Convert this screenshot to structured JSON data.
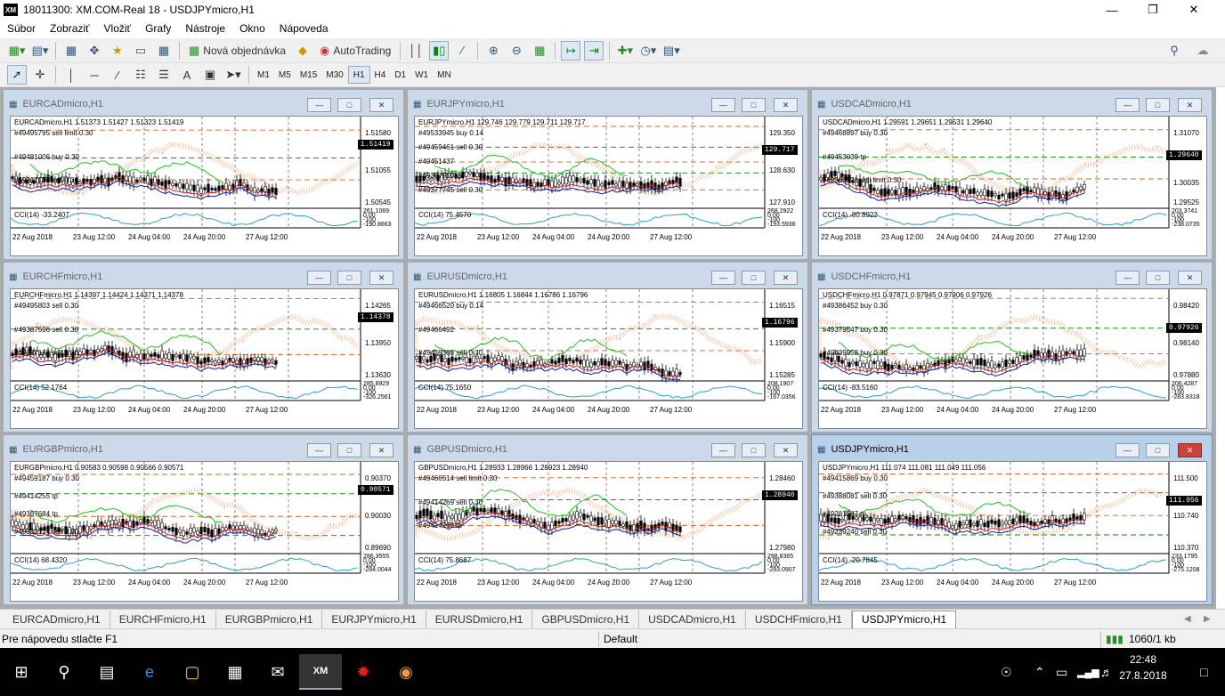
{
  "window": {
    "title": "18011300: XM.COM-Real 18 - USDJPYmicro,H1",
    "app_icon": "XM"
  },
  "menu": [
    "Súbor",
    "Zobraziť",
    "Vložiť",
    "Grafy",
    "Nástroje",
    "Okno",
    "Nápoveda"
  ],
  "toolbar": {
    "new_order": "Nová objednávka",
    "autotrading": "AutoTrading"
  },
  "timeframes": [
    "M1",
    "M5",
    "M15",
    "M30",
    "H1",
    "H4",
    "D1",
    "W1",
    "MN"
  ],
  "active_timeframe": "H1",
  "x_axis_labels": [
    "22 Aug 2018",
    "23 Aug 12:00",
    "24 Aug 04:00",
    "24 Aug 20:00",
    "27 Aug 12:00"
  ],
  "charts": [
    {
      "window_title": "EURCADmicro,H1",
      "header": "EURCADmicro,H1  1.51373 1.51427 1.51323 1.51419",
      "orders": [
        "#49495795 sell limit 0.30",
        "#49481006 buy 0.30",
        "#49312124 sell 0.30"
      ],
      "prices": [
        "1.51580",
        "1.51055",
        "1.50545"
      ],
      "current_price": "1.51419",
      "cci": "CCI(14) -33.2407",
      "cci_scale": [
        "261.1069",
        "0.00",
        "-100",
        "-190.8663"
      ]
    },
    {
      "window_title": "EURJPYmicro,H1",
      "header": "EURJPYmicro,H1  129.746 129.779 129.711 129.717",
      "orders": [
        "#49533945 buy 0.14",
        "#49459461 sell 0.30",
        "#49451437",
        "#49387915 tp",
        "#49377745 sell 0.30"
      ],
      "prices": [
        "129.350",
        "128.630",
        "127.910"
      ],
      "current_price": "129.717",
      "cci": "CCI(14) 75.4570",
      "cci_scale": [
        "268.2922",
        "0.00",
        "-100",
        "-193.5936"
      ]
    },
    {
      "window_title": "USDCADmicro,H1",
      "header": "USDCADmicro,H1  1.29591 1.29651 1.29531 1.29640",
      "orders": [
        "#49468897 buy 0.30",
        "#49453039 tp",
        "#49366521 sell limit 0.30"
      ],
      "prices": [
        "1.31070",
        "1.30560",
        "1.30035",
        "1.29525"
      ],
      "current_price": "1.29640",
      "cci": "CCI(14) -80.8922",
      "cci_scale": [
        "203.3741",
        "0.00",
        "-100",
        "-238.0735"
      ]
    },
    {
      "window_title": "EURCHFmicro,H1",
      "header": "EURCHFmicro,H1  1.14397 1.14424 1.14371 1.14378",
      "orders": [
        "#49495803 sell 0.30",
        "#49387596 sell 0.30",
        "#49297168 sell 0.30"
      ],
      "prices": [
        "1.14265",
        "1.13950",
        "1.13630"
      ],
      "current_price": "1.14378",
      "cci": "CCI(14) 52.1764",
      "cci_scale": [
        "285.8929",
        "0.00",
        "-100",
        "-326.2561"
      ]
    },
    {
      "window_title": "EURUSDmicro,H1",
      "header": "EURUSDmicro,H1  1.16805 1.16844 1.16786 1.16796",
      "orders": [
        "#49466520 buy 0.14",
        "#49466492",
        "#49419386 sell 0.30"
      ],
      "prices": [
        "1.16515",
        "1.15900",
        "1.15285"
      ],
      "current_price": "1.16796",
      "cci": "CCI(14) 75.1650",
      "cci_scale": [
        "208.1907",
        "0.00",
        "-100",
        "-167.0356"
      ]
    },
    {
      "window_title": "USDCHFmicro,H1",
      "header": "USDCHFmicro,H1  0.97871 0.97945 0.97906 0.97926",
      "orders": [
        "#49386452 buy 0.30",
        "#49379547 buy 0.30",
        "#49439958 buy 0.30"
      ],
      "prices": [
        "0.98420",
        "0.98140",
        "0.97880"
      ],
      "current_price": "0.97926",
      "cci": "CCI(14) -83.5160",
      "cci_scale": [
        "206.4287",
        "0.00",
        "-100",
        "-283.8318"
      ]
    },
    {
      "window_title": "EURGBPmicro,H1",
      "header": "EURGBPmicro,H1  0.90583 0.90598 0.90566 0.90571",
      "orders": [
        "#49459187 buy 0.30",
        "#49414255 tp",
        "#49387684 tp",
        "#49312124 sell 0.30"
      ],
      "prices": [
        "0.90370",
        "0.90030",
        "0.89690"
      ],
      "current_price": "0.90571",
      "cci": "CCI(14) 68.4320",
      "cci_scale": [
        "286.3555",
        "0.00",
        "-100",
        "-284.0044"
      ]
    },
    {
      "window_title": "GBPUSDmicro,H1",
      "header": "GBPUSDmicro,H1  1.28933 1.28966 1.28923 1.28940",
      "orders": [
        "#49466514 sell limit 0.30",
        "#49414269 sell 0.30",
        "#49414268 tp"
      ],
      "prices": [
        "1.28460",
        "1.27980"
      ],
      "current_price": "1.28940",
      "cci": "CCI(14) 75.8687",
      "cci_scale": [
        "298.8365",
        "0.00",
        "-100",
        "-283.0907"
      ]
    },
    {
      "window_title": "USDJPYmicro,H1",
      "header": "USDJPYmicro,H1  111.074 111.081 111.049 111.056",
      "orders": [
        "#49415869 buy 0.30",
        "#49388081 sell 0.30",
        "#49281587 tp",
        "#49239240 sell 0.30"
      ],
      "prices": [
        "111.500",
        "110.740",
        "110.370"
      ],
      "current_price": "111.056",
      "cci": "CCI(14) -20.7845",
      "cci_scale": [
        "233.1795",
        "0.00",
        "-100",
        "-275.1208"
      ]
    }
  ],
  "tabs": [
    "EURCADmicro,H1",
    "EURCHFmicro,H1",
    "EURGBPmicro,H1",
    "EURJPYmicro,H1",
    "EURUSDmicro,H1",
    "GBPUSDmicro,H1",
    "USDCADmicro,H1",
    "USDCHFmicro,H1",
    "USDJPYmicro,H1"
  ],
  "active_tab": "USDJPYmicro,H1",
  "status": {
    "help": "Pre nápovedu stlačte F1",
    "profile": "Default",
    "traffic": "1060/1 kb"
  },
  "clock": {
    "time": "22:48",
    "date": "27.8.2018"
  },
  "colors": {
    "bull": "#000000",
    "bear": "#000000",
    "ichimoku_cloud": "#e8a070",
    "tenkan": "#d02020",
    "kijun": "#1a1aa0",
    "chikou": "#20c020",
    "cci": "#2aa0c0",
    "order_line": "#008000",
    "grid": "#555555"
  }
}
